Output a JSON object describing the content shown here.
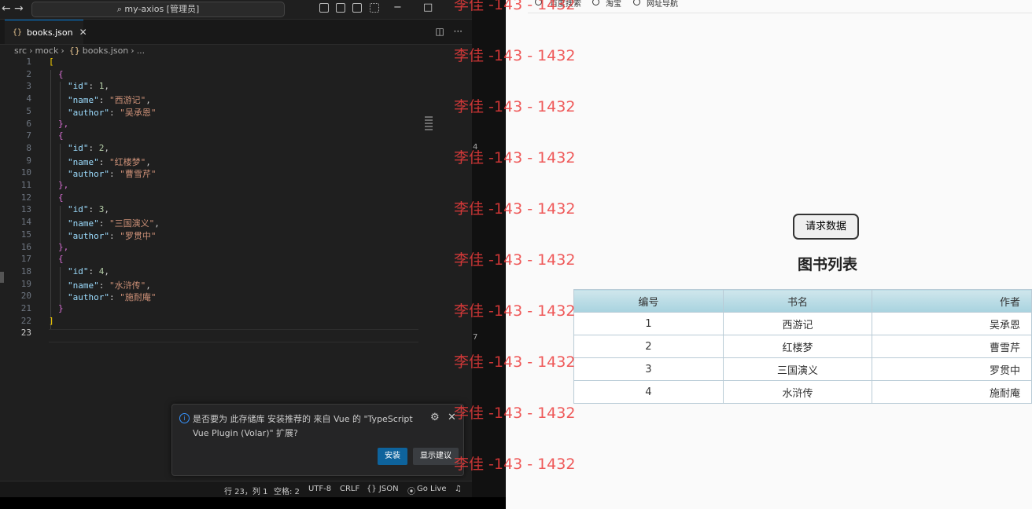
{
  "vscode": {
    "title": "my-axios [管理员]",
    "nav_back": "←",
    "nav_fwd": "→",
    "search_glyph": "⌕",
    "tab": {
      "icon": "{}",
      "label": "books.json",
      "close": "✕"
    },
    "breadcrumb": {
      "seg1": "src",
      "seg2": "mock",
      "icon": "{}",
      "seg3": "books.json",
      "seg4": "..."
    },
    "code_lines": [
      {
        "no": "1"
      },
      {
        "no": "2"
      },
      {
        "no": "3"
      },
      {
        "no": "4"
      },
      {
        "no": "5"
      },
      {
        "no": "6"
      },
      {
        "no": "7"
      },
      {
        "no": "8"
      },
      {
        "no": "9"
      },
      {
        "no": "10"
      },
      {
        "no": "11"
      },
      {
        "no": "12"
      },
      {
        "no": "13"
      },
      {
        "no": "14"
      },
      {
        "no": "15"
      },
      {
        "no": "16"
      },
      {
        "no": "17"
      },
      {
        "no": "18"
      },
      {
        "no": "19"
      },
      {
        "no": "20"
      },
      {
        "no": "21"
      },
      {
        "no": "22"
      },
      {
        "no": "23"
      }
    ],
    "json_keys": {
      "id": "\"id\"",
      "name": "\"name\"",
      "author": "\"author\""
    },
    "books": [
      {
        "id": "1",
        "name": "\"西游记\"",
        "author": "\"吴承恩\""
      },
      {
        "id": "2",
        "name": "\"红楼梦\"",
        "author": "\"曹雪芹\""
      },
      {
        "id": "3",
        "name": "\"三国演义\"",
        "author": "\"罗贯中\""
      },
      {
        "id": "4",
        "name": "\"水浒传\"",
        "author": "\"施耐庵\""
      }
    ],
    "punct": {
      "open_arr": "[",
      "close_arr": "]",
      "open_obj": "{",
      "close_obj": "}",
      "close_obj_comma": "},",
      "colon": ": ",
      "comma": ","
    },
    "notification": {
      "message": "是否要为 此存储库 安装推荐的 来自 Vue 的 \"TypeScript Vue Plugin (Volar)\" 扩展?",
      "install": "安装",
      "show": "显示建议"
    },
    "status": {
      "position": "行 23，列 1",
      "spaces": "空格: 2",
      "encoding": "UTF-8",
      "eol": "CRLF",
      "lang": "{} JSON",
      "golive": "Go Live"
    },
    "stray": [
      "4",
      "7"
    ]
  },
  "browser": {
    "bookmarks": [
      "百度搜索",
      "淘宝",
      "网址导航"
    ],
    "button": "请求数据",
    "heading": "图书列表",
    "table": {
      "headers": [
        "编号",
        "书名",
        "作者"
      ],
      "rows": [
        [
          "1",
          "西游记",
          "吴承恩"
        ],
        [
          "2",
          "红楼梦",
          "曹雪芹"
        ],
        [
          "3",
          "三国演义",
          "罗贯中"
        ],
        [
          "4",
          "水浒传",
          "施耐庵"
        ]
      ]
    }
  },
  "watermark": "李佳 -143 - 1432",
  "colors": {
    "accent": "#0078d4",
    "watermark": "#ec3c3c",
    "table_header": "#a8d3df"
  }
}
